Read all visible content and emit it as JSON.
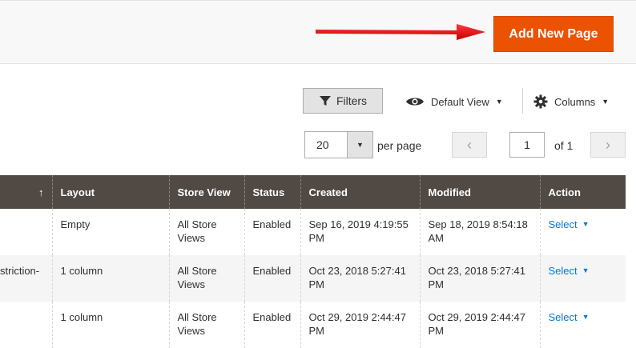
{
  "toolbar": {
    "add_label": "Add New Page",
    "filters_label": "Filters",
    "view_label": "Default View",
    "columns_label": "Columns"
  },
  "pager": {
    "per_page_value": "20",
    "per_page_label": "per page",
    "current_page": "1",
    "of_label": "of 1"
  },
  "grid": {
    "headers": {
      "sort": "↑",
      "layout": "Layout",
      "store_view": "Store View",
      "status": "Status",
      "created": "Created",
      "modified": "Modified",
      "action": "Action"
    },
    "rows": [
      {
        "title": "",
        "layout": "Empty",
        "store_view": "All Store Views",
        "status": "Enabled",
        "created": "Sep 16, 2019 4:19:55 PM",
        "modified": "Sep 18, 2019 8:54:18 AM",
        "action": "Select"
      },
      {
        "title": "striction-",
        "layout": "1 column",
        "store_view": "All Store Views",
        "status": "Enabled",
        "created": "Oct 23, 2018 5:27:41 PM",
        "modified": "Oct 23, 2018 5:27:41 PM",
        "action": "Select"
      },
      {
        "title": "",
        "layout": "1 column",
        "store_view": "All Store Views",
        "status": "Enabled",
        "created": "Oct 29, 2019 2:44:47 PM",
        "modified": "Oct 29, 2019 2:44:47 PM",
        "action": "Select"
      }
    ]
  },
  "colors": {
    "accent": "#eb5202",
    "header_bg": "#514943",
    "link": "#007bdb",
    "annotation_arrow": "#e02020"
  },
  "icons": {
    "filter": "funnel-icon",
    "view": "eye-icon",
    "columns": "gear-icon"
  }
}
